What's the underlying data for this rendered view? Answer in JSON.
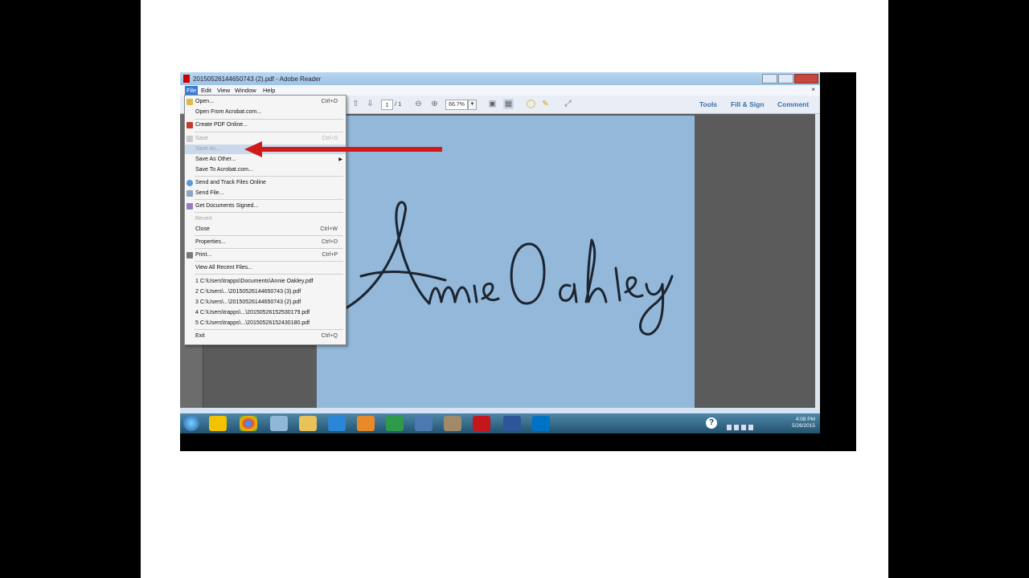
{
  "window": {
    "title": "20150526144650743 (2).pdf - Adobe Reader"
  },
  "menubar": {
    "items": [
      "File",
      "Edit",
      "View",
      "Window",
      "Help"
    ],
    "close_doc": "×"
  },
  "toolbar": {
    "page_current": "1",
    "page_total": "/ 1",
    "zoom": "66.7%",
    "tools": "Tools",
    "fill_sign": "Fill & Sign",
    "comment": "Comment"
  },
  "file_menu": {
    "open": {
      "label": "Open...",
      "shortcut": "Ctrl+O"
    },
    "open_acrobat": {
      "label": "Open From Acrobat.com..."
    },
    "create_pdf": {
      "label": "Create PDF Online..."
    },
    "save": {
      "label": "Save",
      "shortcut": "Ctrl+S"
    },
    "save_as": {
      "label": "Save As..."
    },
    "save_as_other": {
      "label": "Save As Other..."
    },
    "save_acrobat": {
      "label": "Save To Acrobat.com..."
    },
    "send_track": {
      "label": "Send and Track Files Online"
    },
    "send_file": {
      "label": "Send File..."
    },
    "get_signed": {
      "label": "Get Documents Signed..."
    },
    "revert": {
      "label": "Revert"
    },
    "close": {
      "label": "Close",
      "shortcut": "Ctrl+W"
    },
    "properties": {
      "label": "Properties...",
      "shortcut": "Ctrl+D"
    },
    "print": {
      "label": "Print...",
      "shortcut": "Ctrl+P"
    },
    "view_recent": {
      "label": "View All Recent Files..."
    },
    "recent": [
      "1 C:\\Users\\trapps\\Documents\\Annie Oakley.pdf",
      "2 C:\\Users\\...\\20150526144650743 (3).pdf",
      "3 C:\\Users\\...\\20150526144650743 (2).pdf",
      "4 C:\\Users\\trapps\\...\\20150526152530179.pdf",
      "5 C:\\Users\\trapps\\...\\20150526152430180.pdf"
    ],
    "exit": {
      "label": "Exit",
      "shortcut": "Ctrl+Q"
    }
  },
  "document": {
    "signature_text": "Annie Oakley"
  },
  "taskbar": {
    "time": "4:08 PM",
    "date": "5/26/2015"
  },
  "colors": {
    "annotation_arrow": "#d11a1a",
    "page_background": "#93b8d9",
    "accent": "#3a7ad6"
  }
}
